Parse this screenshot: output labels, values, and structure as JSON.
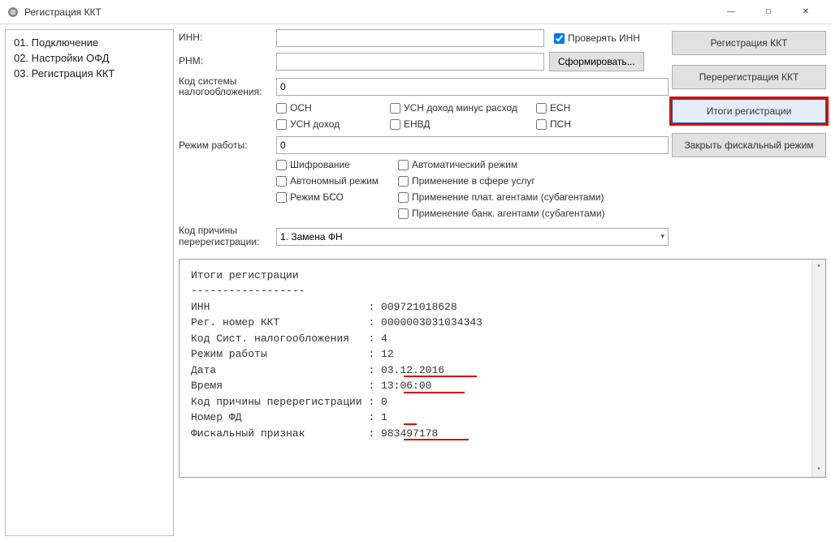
{
  "window": {
    "title": "Регистрация ККТ"
  },
  "sidebar": {
    "items": [
      {
        "label": "01. Подключение"
      },
      {
        "label": "02. Настройки ОФД"
      },
      {
        "label": "03. Регистрация ККТ"
      }
    ]
  },
  "form": {
    "inn_label": "ИНН:",
    "inn_value": "",
    "check_inn": "Проверять ИНН",
    "rnm_label": "РНМ:",
    "rnm_value": "",
    "generate_btn": "Сформировать...",
    "tax_code_label": "Код системы налогообложения:",
    "tax_code_value": "0",
    "tax_options": {
      "osn": "ОСН",
      "usn_exp": "УСН доход минус расход",
      "eshn": "ЕСН",
      "usn_inc": "УСН доход",
      "envd": "ЕНВД",
      "psn": "ПСН"
    },
    "mode_label": "Режим работы:",
    "mode_value": "0",
    "mode_options": {
      "encrypt": "Шифрование",
      "auto": "Автоматический режим",
      "autonomous": "Автономный режим",
      "services": "Применение в сфере услуг",
      "bso": "Режим БСО",
      "pay_agents": "Применение плат. агентами (субагентами)",
      "bank_agents": "Применение банк. агентами (субагентами)"
    },
    "rereg_label": "Код причины перерегистрации:",
    "rereg_value": "1. Замена ФН"
  },
  "buttons": {
    "register": "Регистрация ККТ",
    "reregister": "Перерегистрация ККТ",
    "results": "Итоги регистрации",
    "close_fiscal": "Закрыть фискальный режим"
  },
  "report": {
    "title": "Итоги регистрации",
    "sep": "------------------",
    "rows": {
      "inn": {
        "k": "ИНН                        ",
        "v": "009721018628"
      },
      "reg": {
        "k": "Рег. номер ККТ             ",
        "v": "0000003031034343"
      },
      "tax": {
        "k": "Код Сист. налогообложения  ",
        "v": "4"
      },
      "mode": {
        "k": "Режим работы               ",
        "v": "12"
      },
      "date": {
        "k": "Дата                       ",
        "v": "03.12.2016"
      },
      "time": {
        "k": "Время                      ",
        "v": "13:06:00"
      },
      "rereg": {
        "k": "Код причины перерегистрации",
        "v": "0"
      },
      "fd": {
        "k": "Номер ФД                   ",
        "v": "1"
      },
      "fisk": {
        "k": "Фискальный признак         ",
        "v": "983497178"
      }
    }
  }
}
